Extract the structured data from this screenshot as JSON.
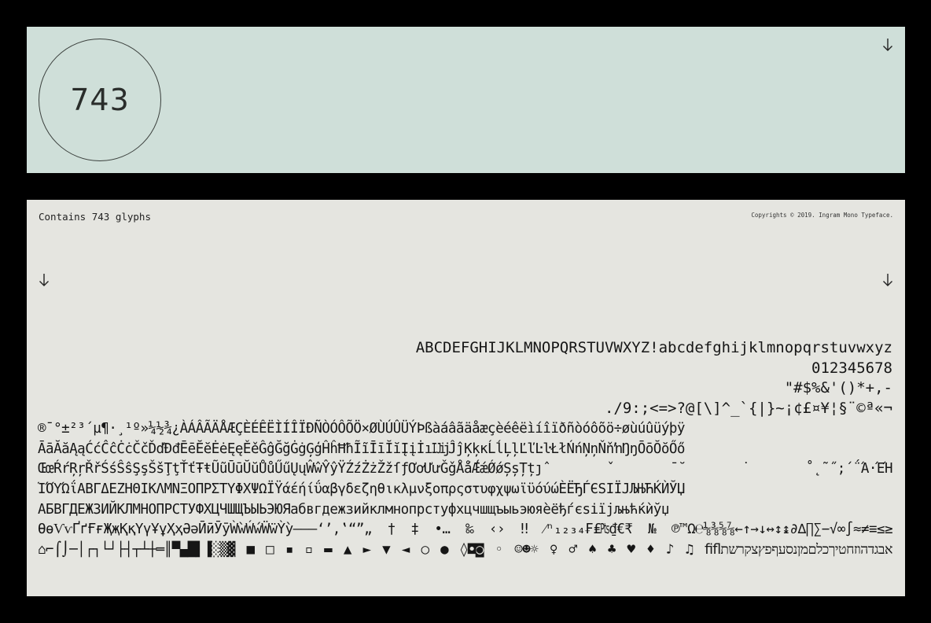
{
  "header_panel": {
    "glyph_count": "743"
  },
  "main_panel": {
    "contains_label": "Contains 743 glyphs",
    "copyright": "Copyrights © 2019. Ingram Mono Typeface."
  },
  "glyph_lines": [
    "ABCDEFGHIJKLMNOPQRSTUVWXYZ!abcdefghijklmnopqrstuvwxyz",
    "012345678",
    "\"#$%&'()*+,-",
    "./9:;<=>?@[\\]^_`{|}~¡¢£¤¥¦§¨©ª«¬",
    "®¯°±²³´µ¶·¸¹º»¼½¾¿ÀÁÂÃÄÅÆÇÈÉÊËÌÍÎÏÐÑÒÓÔÕÖ×ØÙÚÛÜÝÞßàáâãäåæçèéêëìíîïðñòóôõö÷øùúûüýþÿ",
    "ĀāĂăĄąĆćĈĉĊċČčĎďĐđĒēĔĕĖėĘęĚěĜĝĞğĠġĢģĤĥĦħĨĩĪīĬĭĮįİıĲĳĴĵĶķĸĹĺĻļĽľĿŀŁłŃńŅņŇňŉŊŋŌōŎŏŐő",
    "ŒœŔŕŖŗŘřŚśŜŝŞşŠšŢţŤťŦŧŨũŪūŬŭŮůŰűŲųŴŵŶŷŸŹźŻżŽžſƒƠơƯưǦǧǺǻǼǽǾǿȘșȚțȷˆˇˉ˘˙˚˛˜˝;΄΅Ά·ΈΉ",
    "ΊΌΎΏΐΑΒΓΔΕΖΗΘΙΚΛΜΝΞΟΠΡΣΤΥΦΧΨΩΪΫάέήίΰαβγδεζηθικλμνξοπρςστυφχψωϊϋόύώЀЁЂЃЄЅІЇЈЉЊЋЌЍЎЏ",
    "АБВГДЕЖЗИЙКЛМНОПРСТУФХЦЧШЩЪЫЬЭЮЯабвгдежзийклмнопрстуфхцчшщъыьэюяѐёђѓєѕіїјљњћќѝўџ",
    "ѲѳѴѵҐґҒғҖҗҚқҮүҰұҲҳӘәӢӣӮӯẀẁẂẃẄẅỲỳ–—―‘’‚‛“”„†‡•…‰‹›‼⁄ⁿ₁₂₃₄₣₤₧₫€₹№℗™Ω℮⅛⅜⅝⅞←↑→↓↔↕↨∂∆∏∑−√∞∫≈≠≡≤≥",
    "⌂⌐⌠⌡─│┌┐└┘├┤┬┴┼═║▀▄█▌▐░▒▓■□▪▫▬▲►▼◄○●◊◘◙◦☺☻☼♀♂♠♣♥♦♪♫ﬁﬂאבגדהוזחטיךכלםמןנסעףפץצקרשת"
  ]
}
